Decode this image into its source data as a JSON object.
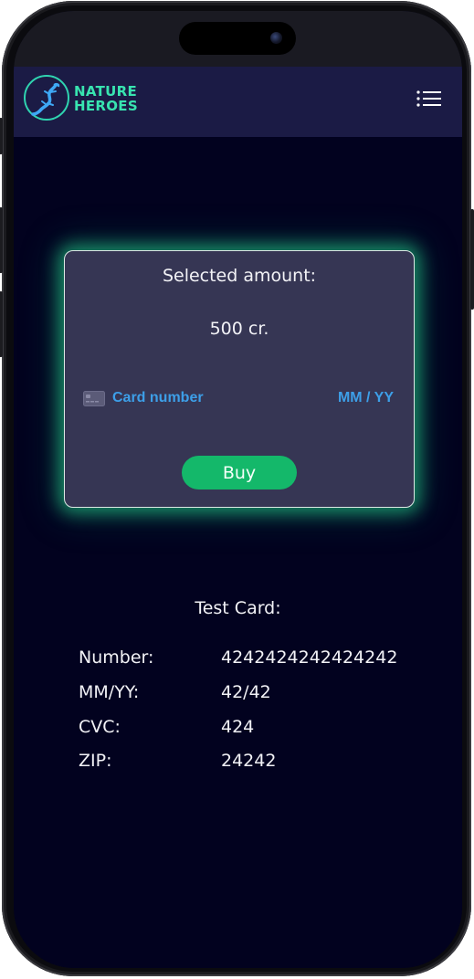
{
  "header": {
    "brand_line1": "NATURE",
    "brand_line2": "HEROES",
    "logo_icon": "lizard-logo-icon",
    "menu_icon": "list-menu-icon"
  },
  "payment": {
    "selected_label": "Selected amount:",
    "amount": "500 cr.",
    "card_icon": "credit-card-icon",
    "card_placeholder": "Card number",
    "expiry_placeholder": "MM / YY",
    "buy_label": "Buy"
  },
  "test_card": {
    "title": "Test Card:",
    "rows": [
      {
        "label": "Number:",
        "value": "4242424242424242"
      },
      {
        "label": "MM/YY:",
        "value": "42/42"
      },
      {
        "label": "CVC:",
        "value": "424"
      },
      {
        "label": "ZIP:",
        "value": "24242"
      }
    ]
  },
  "colors": {
    "background": "#02021f",
    "navbar": "#1b1b45",
    "brand": "#38e4b0",
    "panel": "#363654",
    "glow": "#28e696",
    "input_text": "#3d9fe8",
    "button": "#14b86a"
  }
}
